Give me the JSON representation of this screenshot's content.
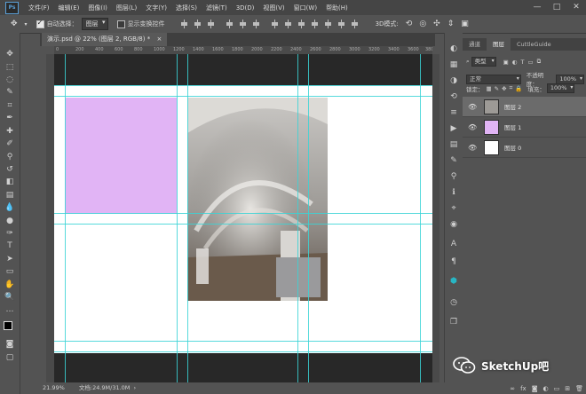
{
  "app": {
    "logo": "Ps",
    "menu": [
      "文件(F)",
      "编辑(E)",
      "图像(I)",
      "图层(L)",
      "文字(Y)",
      "选择(S)",
      "滤镜(T)",
      "3D(D)",
      "视图(V)",
      "窗口(W)",
      "帮助(H)"
    ],
    "window_controls": [
      "—",
      "□",
      "✕"
    ]
  },
  "options_bar": {
    "auto_select_label": "自动选择：",
    "auto_select_value": "图层",
    "show_transform_label": "显示变换控件"
  },
  "document": {
    "tab_title": "演示.psd @ 22% (图层 2, RGB/8) *",
    "ruler_ticks": [
      "0",
      "200",
      "400",
      "600",
      "800",
      "1000",
      "1200",
      "1400",
      "1600",
      "1800",
      "2000",
      "2200",
      "2400",
      "2600",
      "2800",
      "3000",
      "3200",
      "3400",
      "3600",
      "3800"
    ]
  },
  "status_bar": {
    "zoom": "21.99%",
    "doc_info": "文档:24.9M/31.0M"
  },
  "layers_panel": {
    "tabs": [
      "通道",
      "图层",
      "CuttleGuide"
    ],
    "active_tab": "图层",
    "filter_label": "类型",
    "blend_mode": "正常",
    "opacity_label": "不透明度：",
    "opacity_value": "100%",
    "lock_label": "锁定：",
    "fill_label": "填充：",
    "fill_value": "100%",
    "layers": [
      {
        "name": "图层 2",
        "selected": true,
        "thumb": "photo"
      },
      {
        "name": "图层 1",
        "selected": false,
        "thumb": "#e1b4f5"
      },
      {
        "name": "图层 0",
        "selected": false,
        "thumb": "#ffffff"
      }
    ]
  },
  "watermark": {
    "text": "SketchUp吧"
  },
  "colors": {
    "guide": "#3ad3d6",
    "pink": "#e1b4f5",
    "foreground": "#000000",
    "background": "#e1b4f5"
  }
}
